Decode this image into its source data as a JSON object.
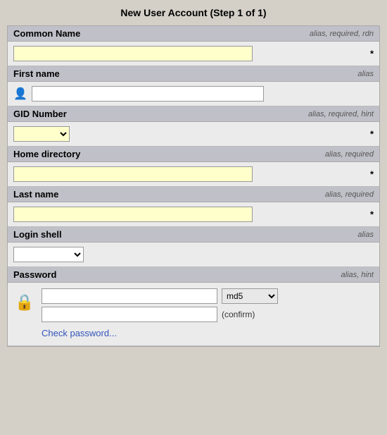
{
  "page": {
    "title": "New User Account (Step 1 of 1)"
  },
  "fields": {
    "common_name": {
      "label": "Common Name",
      "meta": "alias, required, rdn",
      "required_marker": "*"
    },
    "first_name": {
      "label": "First name",
      "meta": "alias"
    },
    "gid_number": {
      "label": "GID Number",
      "meta": "alias, required, hint",
      "required_marker": "*"
    },
    "home_directory": {
      "label": "Home directory",
      "meta": "alias, required",
      "required_marker": "*"
    },
    "last_name": {
      "label": "Last name",
      "meta": "alias, required",
      "required_marker": "*"
    },
    "login_shell": {
      "label": "Login shell",
      "meta": "alias"
    },
    "password": {
      "label": "Password",
      "meta": "alias, hint",
      "confirm_label": "(confirm)",
      "md5_option": "md5",
      "check_link": "Check password..."
    }
  }
}
